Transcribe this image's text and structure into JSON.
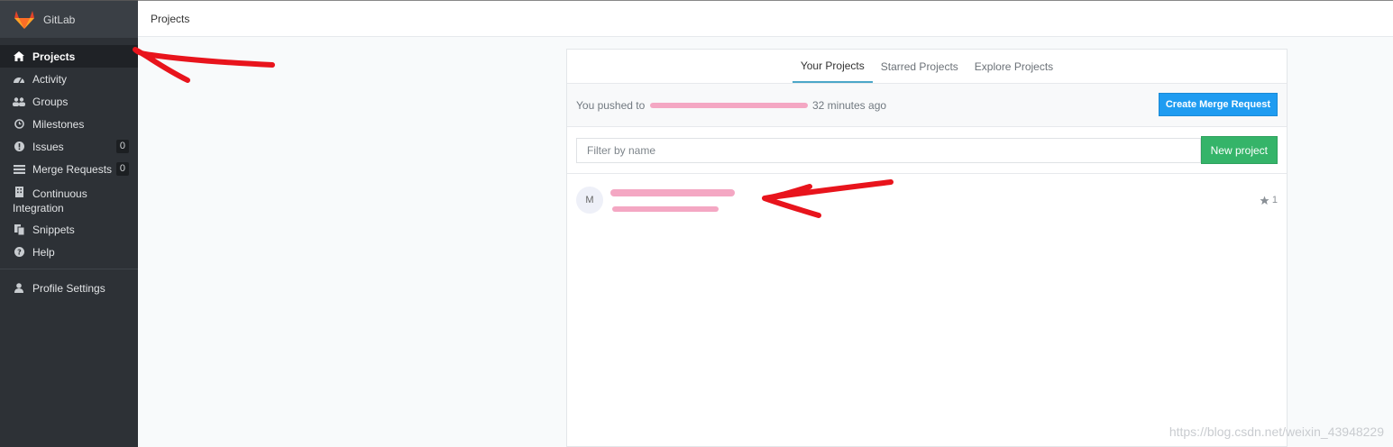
{
  "brand": {
    "name": "GitLab"
  },
  "header": {
    "title": "Projects"
  },
  "sidebar": {
    "items": [
      {
        "label": "Projects",
        "icon": "home-icon",
        "active": true
      },
      {
        "label": "Activity",
        "icon": "dashboard-icon"
      },
      {
        "label": "Groups",
        "icon": "users-icon"
      },
      {
        "label": "Milestones",
        "icon": "clock-icon"
      },
      {
        "label": "Issues",
        "icon": "exclamation-circle-icon",
        "count": "0"
      },
      {
        "label": "Merge Requests",
        "icon": "list-icon",
        "count": "0"
      },
      {
        "label_line1": "Continuous",
        "label_line2": "Integration",
        "icon": "building-icon"
      },
      {
        "label": "Snippets",
        "icon": "files-icon"
      },
      {
        "label": "Help",
        "icon": "question-circle-icon"
      }
    ],
    "profile": {
      "label": "Profile Settings",
      "icon": "user-icon"
    }
  },
  "tabs": [
    {
      "label": "Your Projects",
      "active": true
    },
    {
      "label": "Starred Projects"
    },
    {
      "label": "Explore Projects"
    }
  ],
  "push_notice": {
    "prefix": "You pushed to",
    "suffix": "32 minutes ago",
    "button": "Create Merge Request"
  },
  "filter": {
    "placeholder": "Filter by name",
    "new_button": "New project"
  },
  "projects": [
    {
      "avatar_letter": "M",
      "stars": "1"
    }
  ],
  "watermark": "https://blog.csdn.net/weixin_43948229",
  "colors": {
    "sidebar_bg": "#2d3136",
    "merge_button": "#1f9cf1",
    "new_button": "#35b469",
    "annotation": "#e8141c",
    "redaction": "#f4a7c3"
  }
}
